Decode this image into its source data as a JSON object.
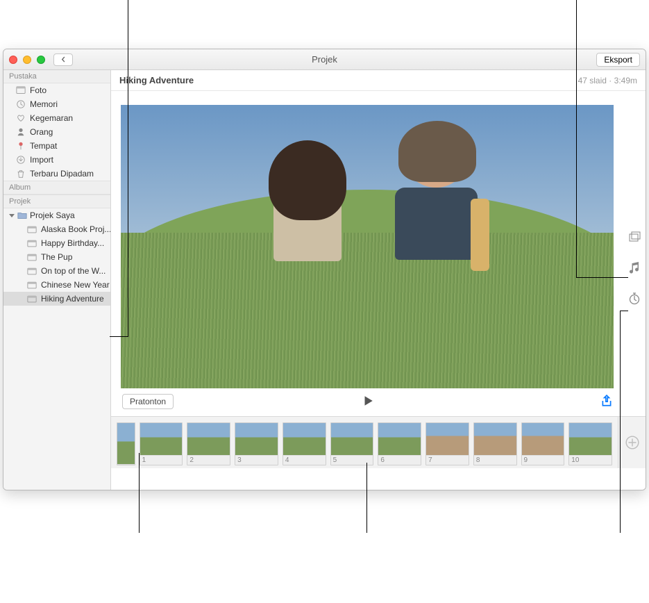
{
  "window": {
    "title": "Projek",
    "export_label": "Eksport"
  },
  "sidebar": {
    "library_header": "Pustaka",
    "library_items": [
      {
        "label": "Foto",
        "icon": "photo"
      },
      {
        "label": "Memori",
        "icon": "clock"
      },
      {
        "label": "Kegemaran",
        "icon": "heart"
      },
      {
        "label": "Orang",
        "icon": "person"
      },
      {
        "label": "Tempat",
        "icon": "pin"
      },
      {
        "label": "Import",
        "icon": "import"
      },
      {
        "label": "Terbaru Dipadam",
        "icon": "trash"
      }
    ],
    "album_header": "Album",
    "project_header": "Projek",
    "my_projects_label": "Projek Saya",
    "projects": [
      {
        "label": "Alaska Book Proj..."
      },
      {
        "label": "Happy Birthday..."
      },
      {
        "label": "The Pup"
      },
      {
        "label": "On top of the W..."
      },
      {
        "label": "Chinese New Year"
      },
      {
        "label": "Hiking Adventure"
      }
    ],
    "selected_project_index": 5
  },
  "project": {
    "title": "Hiking Adventure",
    "slide_count_label": "47 slaid",
    "duration_label": "3:49m",
    "preview_button_label": "Pratonton"
  },
  "thumbnails": {
    "count": 10,
    "numbers": [
      "1",
      "2",
      "3",
      "4",
      "5",
      "6",
      "7",
      "8",
      "9",
      "10"
    ]
  }
}
